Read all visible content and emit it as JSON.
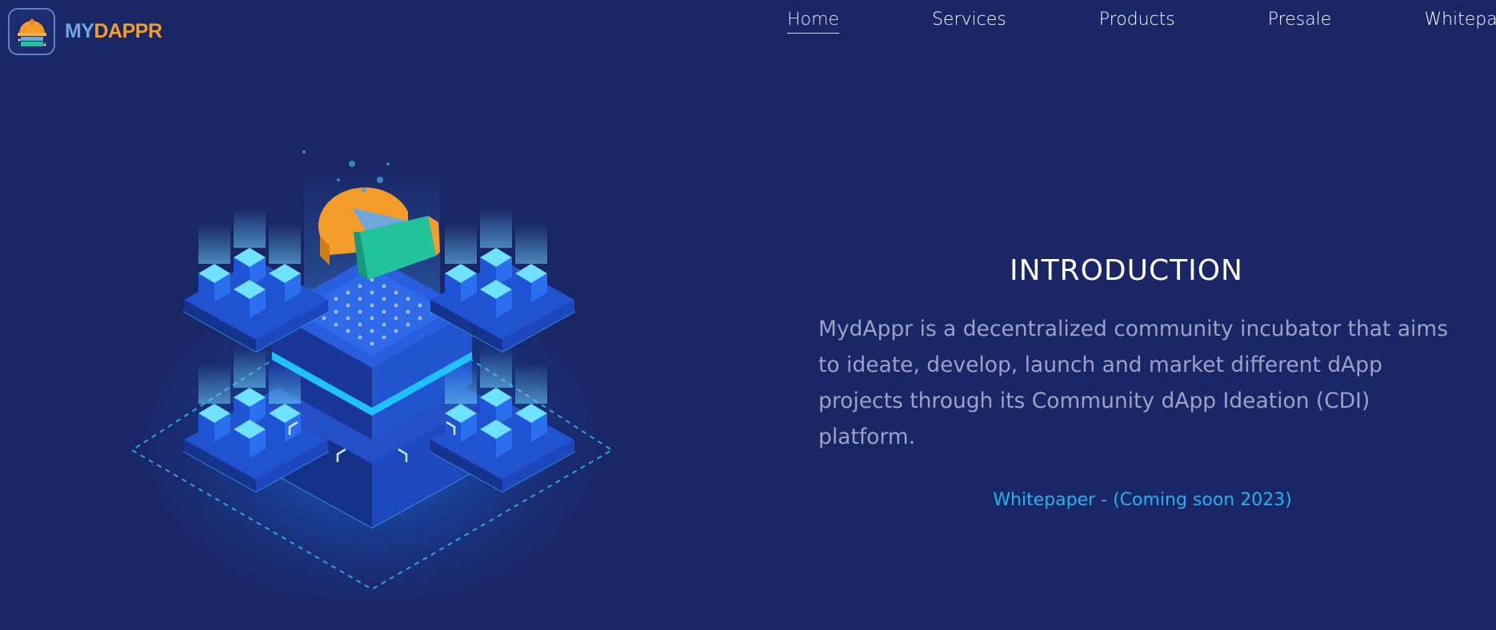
{
  "header": {
    "logo": {
      "icon": "helmet-logo-icon",
      "text_my": "MY",
      "text_dappr": "DAPPR"
    },
    "nav": [
      {
        "label": "Home",
        "active": true
      },
      {
        "label": "Services",
        "active": false
      },
      {
        "label": "Products",
        "active": false
      },
      {
        "label": "Presale",
        "active": false
      },
      {
        "label": "Whitepaper",
        "active": false
      }
    ]
  },
  "illustration": {
    "icon": "isometric-blockchain-incubator-illustration"
  },
  "intro": {
    "title": "INTRODUCTION",
    "body": "MydAppr is a decentralized community incubator that aims to ideate, develop, launch and market different dApp projects through its Community dApp Ideation (CDI) platform.",
    "link": "Whitepaper - (Coming soon 2023)"
  },
  "colors": {
    "background": "#1a2766",
    "accent_blue": "#26b0ef",
    "logo_orange": "#f59d2a",
    "logo_blue": "#6fa6dc",
    "body_text": "#9aa3c4"
  }
}
